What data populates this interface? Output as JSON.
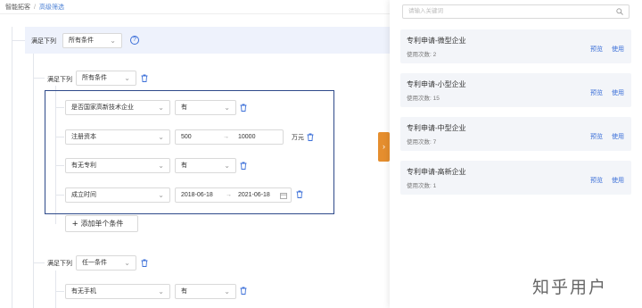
{
  "breadcrumb": {
    "parent": "智能拓客",
    "separator": "/",
    "current": "高级筛选"
  },
  "root_group": {
    "prefix": "满足下列",
    "match_select": "所有条件"
  },
  "group1": {
    "prefix": "满足下列",
    "match_select": "所有条件",
    "rows": [
      {
        "field": "是否国家高新技术企业",
        "op": "有"
      },
      {
        "field": "注册资本",
        "min": "500",
        "max": "10000",
        "unit": "万元"
      },
      {
        "field": "有无专利",
        "op": "有"
      },
      {
        "field": "成立时间",
        "start": "2018-06-18",
        "arrow": "→",
        "end": "2021-06-18"
      }
    ],
    "add_button": "添加单个条件"
  },
  "group2": {
    "prefix": "满足下列",
    "match_select": "任一条件",
    "rows": [
      {
        "field": "有无手机",
        "op": "有"
      }
    ]
  },
  "panel": {
    "search_placeholder": "请输入关键词",
    "cards": [
      {
        "title": "专利申请-微型企业",
        "usage": "使用次数: 2",
        "preview": "预览",
        "use": "使用"
      },
      {
        "title": "专利申请-小型企业",
        "usage": "使用次数: 15",
        "preview": "预览",
        "use": "使用"
      },
      {
        "title": "专利申请-中型企业",
        "usage": "使用次数: 7",
        "preview": "预览",
        "use": "使用"
      },
      {
        "title": "专利申请-高新企业",
        "usage": "使用次数: 1",
        "preview": "预览",
        "use": "使用"
      }
    ]
  },
  "watermark": "知乎用户",
  "colors": {
    "accent": "#3b6fd8",
    "handle": "#e58e2e",
    "highlight_border": "#2e4a8a",
    "root_bar": "#eef2fc"
  }
}
